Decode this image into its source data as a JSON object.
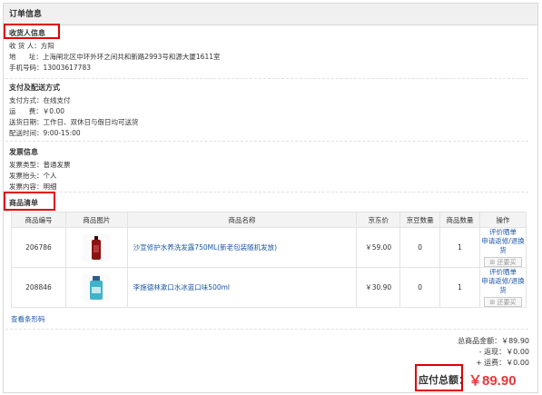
{
  "header": {
    "title": "订单信息"
  },
  "consignee": {
    "title": "收货人信息",
    "name_label": "收 货 人：",
    "name": "方阳",
    "address_label": "地      址：",
    "address": "上海闸北区中环外环之间共和新路2993号和源大厦1611室",
    "phone_label": "手机号码：",
    "phone": "13003617783"
  },
  "payment": {
    "title": "支付及配送方式",
    "method_label": "支付方式：",
    "method": "在线支付",
    "freight_label": "运      费：",
    "freight": "￥0.00",
    "delivery_date_label": "送货日期：",
    "delivery_date": "工作日、双休日与假日均可送货",
    "delivery_time_label": "配送时间：",
    "delivery_time": "9:00-15:00"
  },
  "invoice": {
    "title": "发票信息",
    "type_label": "发票类型：",
    "type": "普通发票",
    "head_label": "发票抬头：",
    "head": "个人",
    "content_label": "发票内容：",
    "content": "明细"
  },
  "goods": {
    "title": "商品清单",
    "columns": [
      "商品编号",
      "商品图片",
      "商品名称",
      "京东价",
      "京豆数量",
      "商品数量",
      "操作"
    ],
    "rows": [
      {
        "id": "206786",
        "name": "沙宣修护水养洗发露750ML(新老包装随机发放)",
        "price": "￥59.00",
        "beans": "0",
        "qty": "1",
        "op1": "评价晒单",
        "op2": "申请返修/退换货",
        "op3": "还要买",
        "thumb_color": "#8a1414"
      },
      {
        "id": "208846",
        "name": "李施德林漱口水冰蓝口味500ml",
        "price": "￥30.90",
        "beans": "0",
        "qty": "1",
        "op1": "评价晒单",
        "op2": "申请返修/退换货",
        "op3": "还要买",
        "thumb_color": "#3fb3c9"
      }
    ],
    "barcode_link": "查看条形码"
  },
  "totals": {
    "goods_label": "总商品金额：",
    "goods_amount": "￥89.90",
    "cashback_label": "- 返现：",
    "cashback": "￥0.00",
    "freight_label": "+ 运费：",
    "freight": "￥0.00",
    "grand_label": "应付总额：",
    "grand_amount": "￥89.90"
  }
}
